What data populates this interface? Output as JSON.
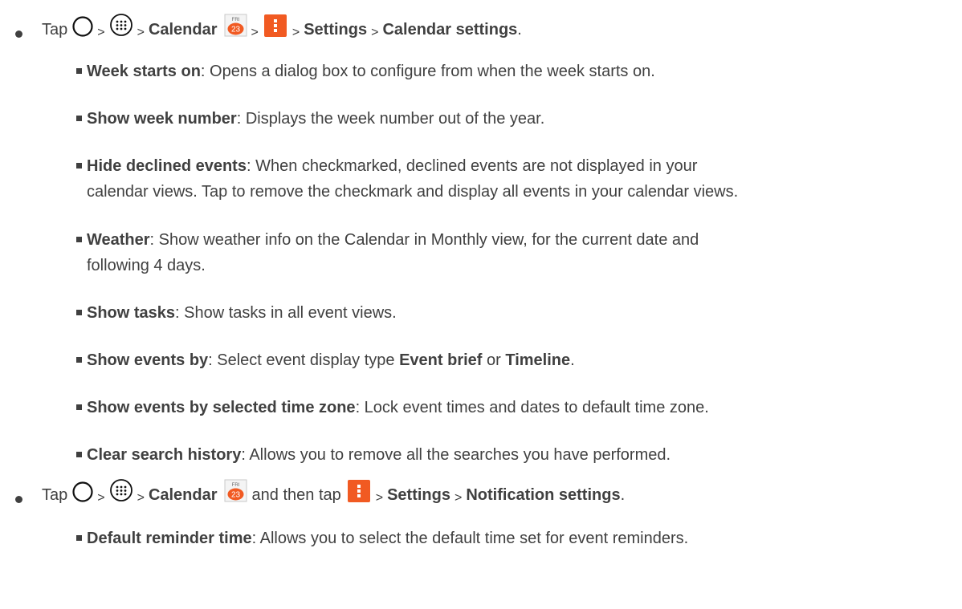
{
  "step1": {
    "tap": "Tap",
    "sep": ">",
    "calendar": "Calendar",
    "calendar_icon": {
      "day": "FRI",
      "date": "23"
    },
    "settings": "Settings",
    "calendar_settings": "Calendar settings",
    "period": "."
  },
  "items1": [
    {
      "term": "Week starts on",
      "desc": ": Opens a dialog box to configure from when the week starts on."
    },
    {
      "term": "Show week number",
      "desc": ": Displays the week number out of the year."
    },
    {
      "term": "Hide declined events",
      "desc": ": When checkmarked, declined events are not displayed in your",
      "desc2": "calendar views. Tap to remove the checkmark and display all events in your calendar views."
    },
    {
      "term": "Weather",
      "desc": ": Show weather info on the Calendar in Monthly view, for the current date and",
      "desc2": "following 4 days."
    },
    {
      "term": "Show tasks",
      "desc": ": Show tasks in all event views."
    },
    {
      "term": "Show events by",
      "desc": ": Select event display type ",
      "opt1": "Event brief",
      "or": " or ",
      "opt2": "Timeline",
      "end": "."
    },
    {
      "term": "Show events by selected time zone",
      "desc": ": Lock event times and dates to default time zone."
    },
    {
      "term": "Clear search history",
      "desc": ": Allows you to remove all the searches you have performed."
    }
  ],
  "step2": {
    "tap": "Tap",
    "sep": ">",
    "calendar": "Calendar",
    "and_then_tap": "and then tap",
    "settings": "Settings",
    "notification_settings": "Notification settings",
    "period": "."
  },
  "items2": [
    {
      "term": "Default reminder time",
      "desc": ": Allows you to select the default time set for event reminders."
    }
  ],
  "colors": {
    "text": "#404040",
    "menu_icon": "#f15a22",
    "calendar_date": "#f15a22"
  },
  "icons": [
    "home-circle-icon",
    "apps-grid-icon",
    "calendar-app-icon",
    "overflow-menu-icon"
  ]
}
